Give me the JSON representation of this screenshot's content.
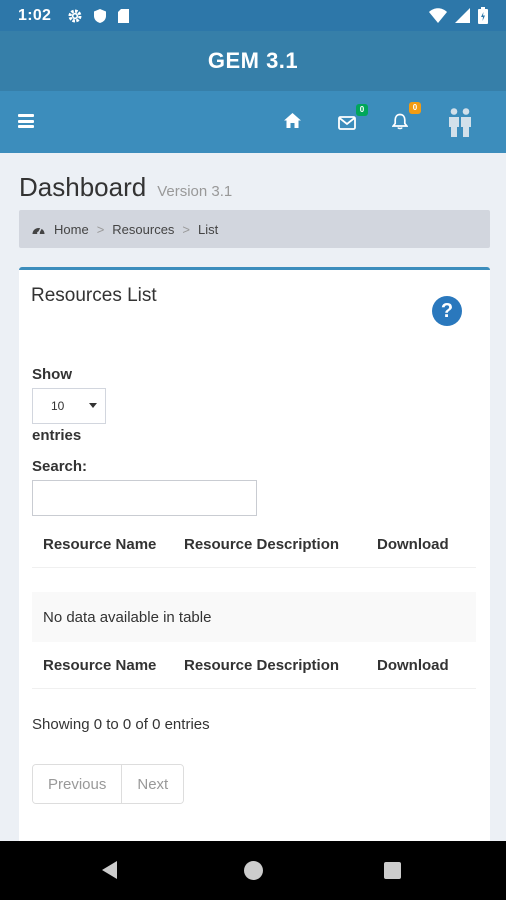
{
  "status_bar": {
    "time": "1:02",
    "icons": [
      "gear-icon",
      "shield-icon",
      "sim-card-icon",
      "wifi-icon",
      "signal-icon",
      "battery-icon"
    ]
  },
  "app": {
    "title": "GEM 3.1"
  },
  "navbar": {
    "mail_badge": "0",
    "notif_badge": "0",
    "mail_badge_color": "#00a65a",
    "notif_badge_color": "#f39c12"
  },
  "content_header": {
    "title": "Dashboard",
    "subtitle": "Version 3.1"
  },
  "breadcrumb": {
    "items": [
      "Home",
      "Resources",
      "List"
    ],
    "separator": ">"
  },
  "box": {
    "title": "Resources List",
    "help_glyph": "?",
    "show_label": "Show",
    "length_value": "10",
    "entries_label": "entries",
    "search_label": "Search:",
    "search_value": "",
    "columns": [
      "Resource Name",
      "Resource Description",
      "Download"
    ],
    "empty_message": "No data available in table",
    "info": "Showing 0 to 0 of 0 entries",
    "prev_label": "Previous",
    "next_label": "Next"
  },
  "colors": {
    "status_bar": "#2d77a9",
    "header": "#367fa9",
    "navbar": "#3c8dbc",
    "accent": "#3c8dbc"
  }
}
